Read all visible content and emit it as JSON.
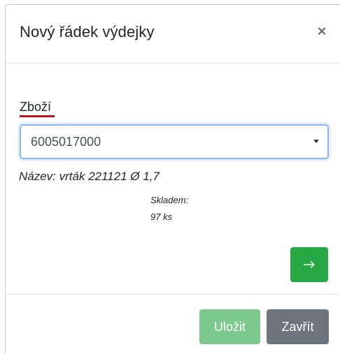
{
  "dialog": {
    "title": "Nový řádek výdejky",
    "close_symbol": "×"
  },
  "form": {
    "product_label": "Zboží",
    "product_select": {
      "selected": "6005017000",
      "options": [
        "6005017000"
      ]
    }
  },
  "product_info": {
    "name_line": "Název: vrták 221121 Ø 1,7",
    "stock_label": "Skladem:",
    "stock_value": "97 ks"
  },
  "actions": {
    "next_icon": "arrow-right-icon"
  },
  "footer": {
    "save_label": "Uložit",
    "close_label": "Zavřít"
  },
  "colors": {
    "success": "#28a745",
    "success_disabled": "#7cc98e",
    "secondary": "#6c757d",
    "label_underline": "#c0151c",
    "focus_border": "#8fb6ef"
  }
}
